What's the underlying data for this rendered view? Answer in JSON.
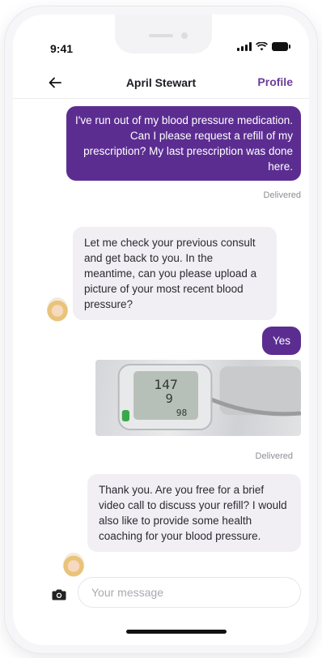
{
  "status_bar": {
    "time": "9:41"
  },
  "header": {
    "back_icon": "arrow-left-icon",
    "title": "April Stewart",
    "profile_label": "Profile"
  },
  "messages": [
    {
      "from": "patient",
      "text": "I've run out of my blood pressure medication. Can I please request a refill of my prescription? My last prescription was done here.",
      "status": "Delivered"
    },
    {
      "from": "doctor",
      "text": "Let me check your previous consult and get back to you. In the meantime, can you please upload a picture of your most recent blood pressure?"
    },
    {
      "from": "patient",
      "text": "Yes"
    },
    {
      "from": "patient",
      "type": "image",
      "alt": "blood pressure monitor reading",
      "reading": {
        "systolic": "147",
        "diastolic": "9",
        "pulse": "98"
      },
      "status": "Delivered"
    },
    {
      "from": "doctor",
      "text": "Thank you. Are you free for a brief video call to discuss your refill? I would also like to provide some health coaching for your blood pressure."
    }
  ],
  "composer": {
    "placeholder": "Your message",
    "camera_icon": "camera-icon"
  },
  "colors": {
    "accent": "#5c2d91",
    "incoming_bubble": "#f1eff4"
  }
}
